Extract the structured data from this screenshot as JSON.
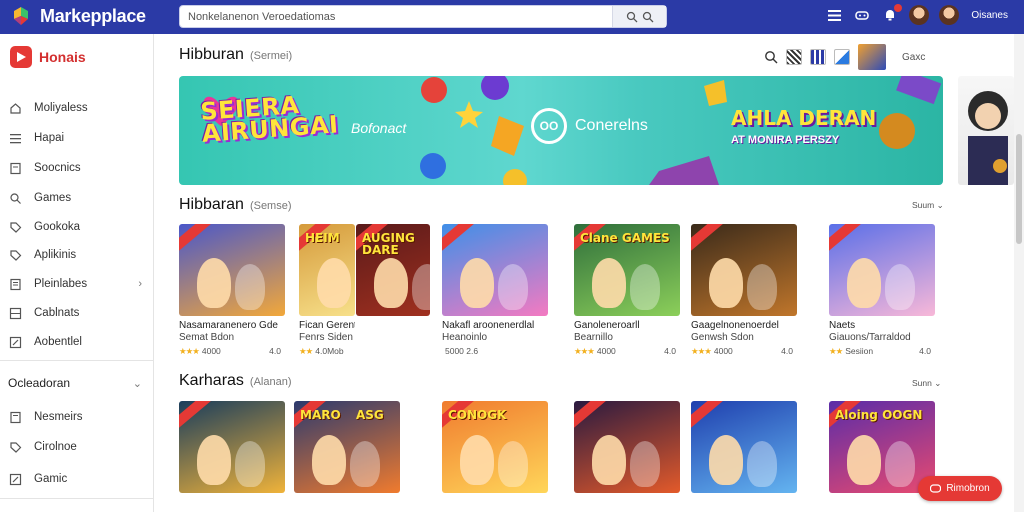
{
  "topbar": {
    "app_title": "Markepplace",
    "search_placeholder": "Nonkelanenon Veroedatiomas",
    "user_name": "Oisanes",
    "notification_count": ""
  },
  "sidebar": {
    "brand": "Honais",
    "items": [
      {
        "label": "Moliyaless",
        "icon": "home-icon"
      },
      {
        "label": "Hapai",
        "icon": "list-icon"
      },
      {
        "label": "Soocnics",
        "icon": "note-icon"
      },
      {
        "label": "Games",
        "icon": "search-icon"
      },
      {
        "label": "Gookoka",
        "icon": "tag-icon"
      },
      {
        "label": "Aplikinis",
        "icon": "tag-icon"
      },
      {
        "label": "Pleinlabes",
        "icon": "document-icon",
        "chevron": "›"
      },
      {
        "label": "Cablnats",
        "icon": "grid-icon"
      },
      {
        "label": "Aobentlel",
        "icon": "edit-icon"
      }
    ],
    "group": {
      "label": "Ocleadoran",
      "chevron": "⌄"
    },
    "group_items": [
      {
        "label": "Nesmeirs",
        "icon": "document-icon"
      },
      {
        "label": "Cirolnoe",
        "icon": "tag-icon"
      },
      {
        "label": "Gamic",
        "icon": "edit-icon"
      }
    ]
  },
  "header": {
    "title": "Hibburan",
    "subtitle": "(Sermei)",
    "extra": "Gaxc"
  },
  "banner": {
    "left_title": "SEIERA AIRUNGAI",
    "left_tagline": "Bofonact",
    "center_logo": "OO",
    "center_text": "Conerelns",
    "right_title": "AHLA DERAN",
    "right_sub": "AT MONIRA PERSZY"
  },
  "section1": {
    "title": "Hibbaran",
    "subtitle": "(Semse)",
    "more": "Suum ⌄",
    "cards": [
      {
        "thumb_title": "",
        "title": "Nasamaranenero Gde",
        "sub": "Semat Bdon",
        "rating": "★★★",
        "rating_text": "4000",
        "meta": "4.0",
        "palette": [
          "#4a57c9",
          "#f2a83a"
        ]
      },
      {
        "thumb_title": "HEIM",
        "title": "Fican Gerenteroordon",
        "sub": "Fenrs Siden",
        "rating": "★★",
        "rating_text": "4.0Mob",
        "meta": "",
        "palette": [
          "#d59a3b",
          "#f7e08a"
        ]
      },
      {
        "thumb_title": "AUGING DARE",
        "title": "",
        "sub": "",
        "rating": "",
        "rating_text": "",
        "meta": "",
        "palette": [
          "#5a1a1a",
          "#a0301f"
        ]
      },
      {
        "thumb_title": "",
        "title": "Nakafl aroonenerdlal",
        "sub": "Heanoinlo",
        "rating": "",
        "rating_text": "5000 2.6",
        "meta": "",
        "palette": [
          "#3f8fe8",
          "#f47ac1"
        ]
      },
      {
        "thumb_title": "Clane GAMES",
        "title": "Ganoleneroarll",
        "sub": "Bearnillo",
        "rating": "★★★",
        "rating_text": "4000",
        "meta": "4.0",
        "palette": [
          "#2e6e3b",
          "#8ccf5a"
        ]
      },
      {
        "thumb_title": "",
        "title": "Gaagelnonenoerdel",
        "sub": "Genwsh Sdon",
        "rating": "★★★",
        "rating_text": "4000",
        "meta": "4.0",
        "palette": [
          "#3a2a1a",
          "#c0762b"
        ]
      },
      {
        "thumb_title": "",
        "title": "Naets",
        "sub": "Giauons/Tarraldod",
        "rating": "★★",
        "rating_text": "Sesiion",
        "meta": "4.0",
        "palette": [
          "#5a6fe8",
          "#f8b8d8"
        ]
      }
    ]
  },
  "section2": {
    "title": "Karharas",
    "subtitle": "(Alanan)",
    "more": "Sunn ⌄",
    "cards": [
      {
        "thumb_title": "",
        "palette": [
          "#1a3d5c",
          "#f0b33a"
        ]
      },
      {
        "thumb_title": "MARO",
        "thumb_title2": "ASG",
        "palette": [
          "#2c3a6e",
          "#f07b2e"
        ]
      },
      {
        "thumb_title": "CONOGK",
        "palette": [
          "#f07b2e",
          "#ffd65a"
        ]
      },
      {
        "thumb_title": "",
        "palette": [
          "#2a1a40",
          "#e35a2a"
        ]
      },
      {
        "thumb_title": "",
        "palette": [
          "#1f3fae",
          "#64b4f0"
        ]
      },
      {
        "thumb_title": "Aloing OOGN",
        "palette": [
          "#5a2ca8",
          "#e84a70"
        ]
      }
    ]
  },
  "fab": {
    "label": "Rimobron"
  },
  "colors": {
    "topbar": "#2b3aa6",
    "accent": "#e53935",
    "banner": "#49c9c0"
  }
}
